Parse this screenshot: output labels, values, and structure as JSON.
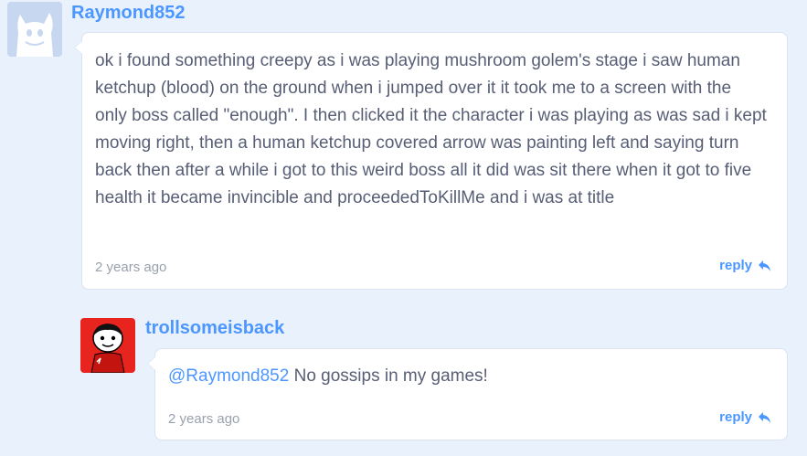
{
  "comments": [
    {
      "username": "Raymond852",
      "avatar": "scratch-cat-avatar",
      "text": "ok i found something creepy as i was playing mushroom golem's stage i saw human ketchup (blood) on the ground when i jumped over it it took me to a screen with the only boss called \"enough\". I then clicked it the character i was playing as was sad i kept moving right, then a human ketchup covered arrow was painting left and saying turn back then after a while i got to this weird boss all it did was sit there when it got to five health it became invincible and proceededToKillMe and i was at title",
      "timestamp": "2 years ago",
      "reply_label": "reply"
    },
    {
      "username": "trollsomeisback",
      "avatar": "red-cartoon-character-avatar",
      "mention": "@Raymond852",
      "text": " No gossips in my games!",
      "timestamp": "2 years ago",
      "reply_label": "reply"
    }
  ],
  "colors": {
    "background": "#e9f1fc",
    "link": "#4c97ff",
    "text": "#575e75",
    "muted": "#9aa1ad"
  }
}
